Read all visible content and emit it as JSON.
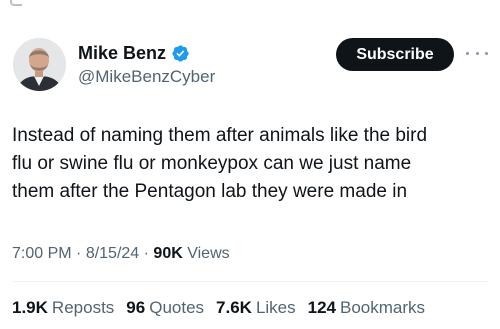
{
  "author": {
    "display_name": "Mike Benz",
    "handle": "@MikeBenzCyber",
    "verified_icon": "verified-badge-icon",
    "verified_color": "#1d9bf0"
  },
  "actions": {
    "subscribe_label": "Subscribe",
    "more_icon": "more-horizontal-icon"
  },
  "tweet": {
    "text": "Instead of naming them after animals like the bird\nflu or swine flu or monkeypox can we just name\nthem after the Pentagon lab they were made in"
  },
  "meta": {
    "time": "7:00 PM",
    "separator": " · ",
    "date": "8/15/24",
    "views_count": "90K",
    "views_label": "Views"
  },
  "stats": {
    "reposts_count": "1.9K",
    "reposts_label": "Reposts",
    "quotes_count": "96",
    "quotes_label": "Quotes",
    "likes_count": "7.6K",
    "likes_label": "Likes",
    "bookmarks_count": "124",
    "bookmarks_label": "Bookmarks"
  },
  "colors": {
    "text_primary": "#0f1419",
    "text_secondary": "#536471",
    "button_bg": "#0f1419",
    "divider": "#eff3f4"
  }
}
